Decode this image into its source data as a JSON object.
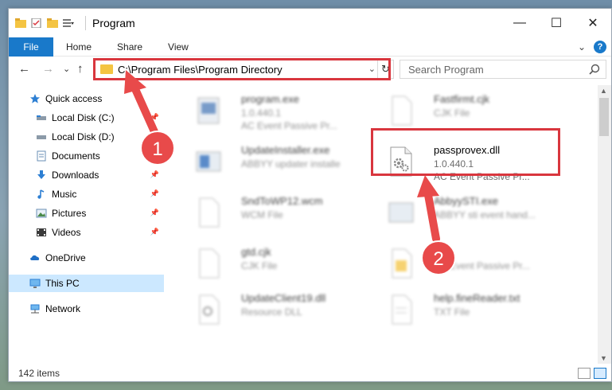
{
  "window": {
    "title": "Program",
    "controls": {
      "minimize": "—",
      "maximize": "☐",
      "close": "✕"
    }
  },
  "ribbon": {
    "file_tab": "File",
    "tabs": [
      "Home",
      "Share",
      "View"
    ],
    "expand": "⌄",
    "help": "?"
  },
  "address": {
    "back": "←",
    "forward": "→",
    "recent": "⌄",
    "up": "↑",
    "path": "C:\\Program Files\\Program Directory",
    "dropdown": "⌄",
    "refresh": "↻"
  },
  "search": {
    "placeholder": "Search Program"
  },
  "nav": {
    "items": [
      {
        "label": "Quick access",
        "icon": "star-icon"
      },
      {
        "label": "Local Disk (C:)",
        "icon": "drive-icon"
      },
      {
        "label": "Local Disk (D:)",
        "icon": "drive-icon"
      },
      {
        "label": "Documents",
        "icon": "documents-icon"
      },
      {
        "label": "Downloads",
        "icon": "download-icon"
      },
      {
        "label": "Music",
        "icon": "music-icon"
      },
      {
        "label": "Pictures",
        "icon": "pictures-icon"
      },
      {
        "label": "Videos",
        "icon": "videos-icon"
      },
      {
        "label": "OneDrive",
        "icon": "cloud-icon"
      },
      {
        "label": "This PC",
        "icon": "computer-icon"
      },
      {
        "label": "Network",
        "icon": "network-icon"
      }
    ],
    "pin": "📌"
  },
  "files": [
    {
      "name": "program.exe",
      "line2": "1.0.440.1",
      "line3": "AC Event Passive Pr..."
    },
    {
      "name": "Fastfirmt.cjk",
      "line2": "CJK File",
      "line3": ""
    },
    {
      "name": "UpdateInstaller.exe",
      "line2": "ABBYY updater installe",
      "line3": ""
    },
    {
      "name": "passprovex.dll",
      "line2": "1.0.440.1",
      "line3": "AC Event Passive Pr..."
    },
    {
      "name": "SndToWP12.wcm",
      "line2": "WCM File",
      "line3": ""
    },
    {
      "name": "AbbyySTI.exe",
      "line2": "ABBYY sti event hand...",
      "line3": ""
    },
    {
      "name": "gtd.cjk",
      "line2": "CJK File",
      "line3": ""
    },
    {
      "name": "eb...",
      "line2": "AC Event Passive Pr...",
      "line3": ""
    },
    {
      "name": "UpdateClient19.dll",
      "line2": "Resource DLL",
      "line3": ""
    },
    {
      "name": "help.fineReader.txt",
      "line2": "TXT File",
      "line3": ""
    }
  ],
  "annotations": {
    "step1": "1",
    "step2": "2"
  },
  "status": {
    "items_count": "142 items"
  },
  "colors": {
    "accent": "#1979ca",
    "highlight": "#d9363e",
    "selection": "#cce8ff"
  }
}
